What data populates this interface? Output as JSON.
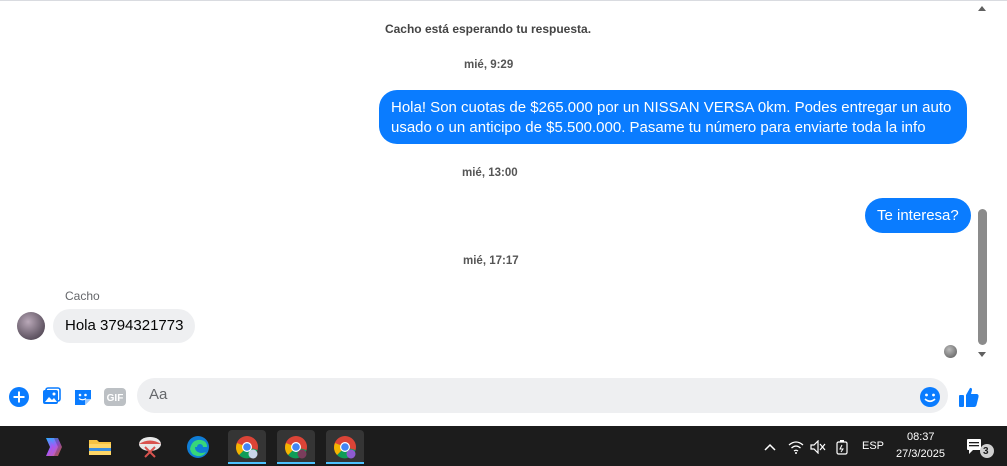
{
  "chat": {
    "status": "Cacho está esperando tu respuesta.",
    "timestamps": [
      "mié, 9:29",
      "mié, 13:00",
      "mié, 17:17"
    ],
    "messages_out": [
      {
        "line1": "Hola! Son cuotas de $265.000 por un NISSAN VERSA 0km. Podes entregar un auto",
        "line2": "usado o un anticipo de $5.500.000. Pasame tu número para enviarte toda la info"
      },
      {
        "text": "Te interesa?"
      }
    ],
    "contact_name": "Cacho",
    "message_in": "Hola 3794321773"
  },
  "composer": {
    "placeholder": "Aa",
    "gif_label": "GIF"
  },
  "taskbar": {
    "language": "ESP",
    "time": "08:37",
    "date": "27/3/2025",
    "notifications": "3"
  },
  "colors": {
    "accent": "#0a7cff",
    "incoming_bubble": "#eeeff1",
    "taskbar": "#1c1c1c"
  }
}
